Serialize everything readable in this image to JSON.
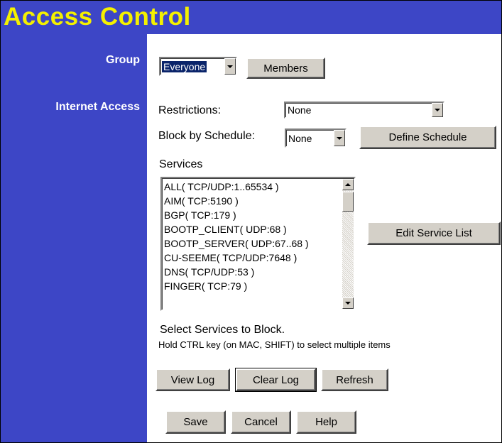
{
  "header": {
    "title": "Access Control"
  },
  "sidebar": {
    "group_label": "Group",
    "internet_access_label": "Internet Access"
  },
  "group": {
    "selected": "Everyone",
    "members_button": "Members"
  },
  "restrictions": {
    "label": "Restrictions:",
    "selected": "None"
  },
  "schedule": {
    "label": "Block by Schedule:",
    "selected": "None",
    "define_button": "Define Schedule"
  },
  "services": {
    "label": "Services",
    "items": [
      "ALL( TCP/UDP:1..65534 )",
      "AIM( TCP:5190 )",
      "BGP( TCP:179 )",
      "BOOTP_CLIENT( UDP:68 )",
      "BOOTP_SERVER( UDP:67..68 )",
      "CU-SEEME( TCP/UDP:7648 )",
      "DNS( TCP/UDP:53 )",
      "FINGER( TCP:79 )"
    ],
    "edit_button": "Edit Service List",
    "instruction": "Select Services to Block.",
    "hint": "Hold CTRL key (on MAC, SHIFT) to select multiple items"
  },
  "log_buttons": {
    "view": "View Log",
    "clear": "Clear Log",
    "refresh": "Refresh"
  },
  "form_buttons": {
    "save": "Save",
    "cancel": "Cancel",
    "help": "Help"
  },
  "colors": {
    "header_bg": "#3d46c6",
    "title_text": "#f4f000",
    "button_face": "#d4d0c8"
  },
  "icons": {
    "dropdown": "chevron-down-icon",
    "scroll_up": "arrow-up-icon",
    "scroll_down": "arrow-down-icon"
  }
}
